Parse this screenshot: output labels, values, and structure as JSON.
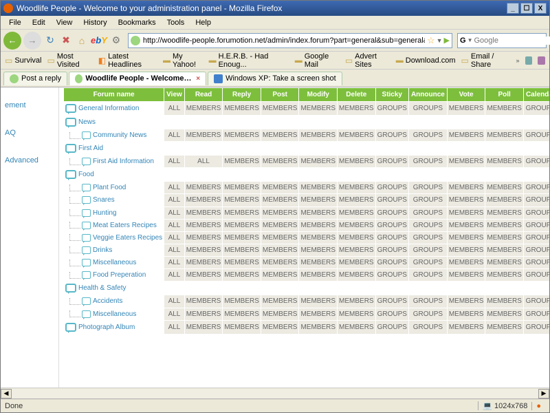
{
  "window": {
    "title": "Woodlife People - Welcome to your administration panel - Mozilla Firefox"
  },
  "menu": {
    "file": "File",
    "edit": "Edit",
    "view": "View",
    "history": "History",
    "bookmarks": "Bookmarks",
    "tools": "Tools",
    "help": "Help"
  },
  "address": {
    "url": "http://woodlife-people.forumotion.net/admin/index.forum?part=general&sub=general&mode="
  },
  "search": {
    "provider": "G",
    "placeholder": "Google"
  },
  "bookmarks": [
    "Survival",
    "Most Visited",
    "Latest Headlines",
    "My Yahoo!",
    "H.E.R.B. - Had Enoug...",
    "Google Mail",
    "Advert Sites",
    "Download.com",
    "Email / Share"
  ],
  "tabs": [
    {
      "label": "Post a reply",
      "active": false,
      "closable": false,
      "bubble": true
    },
    {
      "label": "Woodlife People - Welcome to yo...",
      "active": true,
      "closable": true,
      "bubble": true
    },
    {
      "label": "Windows XP: Take a screen shot",
      "active": false,
      "closable": false,
      "bubble": false
    }
  ],
  "sidebarItems": [
    "ement",
    "AQ",
    "Advanced"
  ],
  "headers": [
    "Forum name",
    "View",
    "Read",
    "Reply",
    "Post",
    "Modify",
    "Delete",
    "Sticky",
    "Announce",
    "Vote",
    "Poll",
    "Calendar"
  ],
  "permDefault": [
    "ALL",
    "MEMBERS",
    "MEMBERS",
    "MEMBERS",
    "MEMBERS",
    "MEMBERS",
    "GROUPS",
    "GROUPS",
    "MEMBERS",
    "MEMBERS",
    "GROUPS"
  ],
  "permAllRead": [
    "ALL",
    "ALL",
    "MEMBERS",
    "MEMBERS",
    "MEMBERS",
    "MEMBERS",
    "GROUPS",
    "GROUPS",
    "MEMBERS",
    "MEMBERS",
    "GROUPS"
  ],
  "rows": [
    {
      "type": "cat",
      "name": "General Information",
      "perm": "permDefault"
    },
    {
      "type": "cat",
      "name": "News"
    },
    {
      "type": "sub",
      "name": "Community News",
      "perm": "permDefault"
    },
    {
      "type": "cat",
      "name": "First Aid"
    },
    {
      "type": "sub",
      "name": "First Aid Information",
      "perm": "permAllRead"
    },
    {
      "type": "cat",
      "name": "Food"
    },
    {
      "type": "sub",
      "name": "Plant Food",
      "perm": "permDefault"
    },
    {
      "type": "sub",
      "name": "Snares",
      "perm": "permDefault"
    },
    {
      "type": "sub",
      "name": "Hunting",
      "perm": "permDefault"
    },
    {
      "type": "sub",
      "name": "Meat Eaters Recipes",
      "perm": "permDefault"
    },
    {
      "type": "sub",
      "name": "Veggie Eaters Recipes",
      "perm": "permDefault"
    },
    {
      "type": "sub",
      "name": "Drinks",
      "perm": "permDefault"
    },
    {
      "type": "sub",
      "name": "Miscellaneous",
      "perm": "permDefault"
    },
    {
      "type": "sub",
      "name": "Food Preperation",
      "perm": "permDefault"
    },
    {
      "type": "cat",
      "name": "Health & Safety"
    },
    {
      "type": "sub",
      "name": "Accidents",
      "perm": "permDefault"
    },
    {
      "type": "sub",
      "name": "Miscellaneous",
      "perm": "permDefault"
    },
    {
      "type": "cat",
      "name": "Photograph Album",
      "perm": "permDefault"
    }
  ],
  "status": {
    "done": "Done",
    "resolution": "1024x768"
  }
}
